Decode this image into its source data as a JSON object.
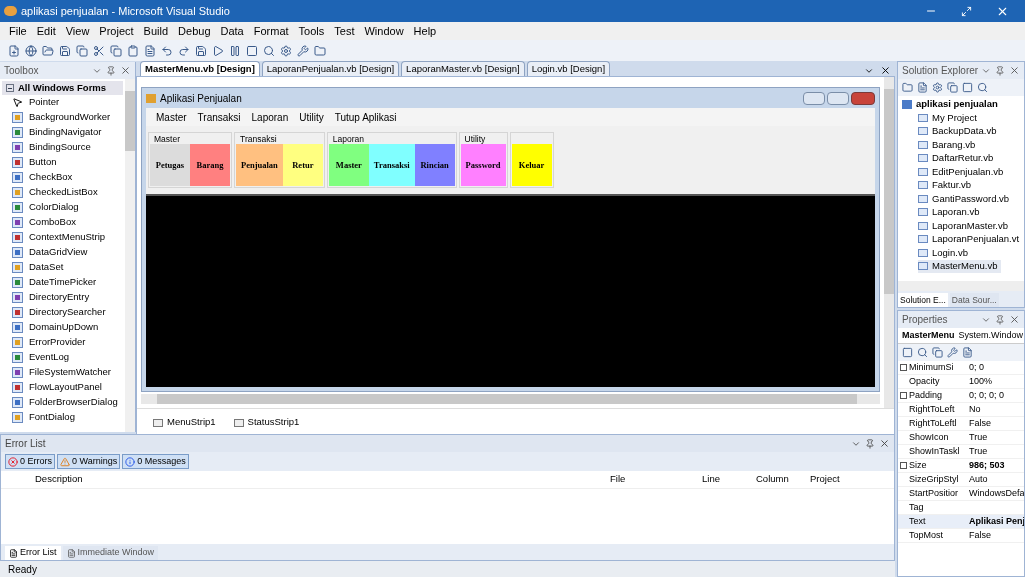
{
  "window": {
    "title": "aplikasi penjualan - Microsoft Visual Studio"
  },
  "menu": [
    "File",
    "Edit",
    "View",
    "Project",
    "Build",
    "Debug",
    "Data",
    "Format",
    "Tools",
    "Test",
    "Window",
    "Help"
  ],
  "toolbox": {
    "title": "Toolbox",
    "category": "All Windows Forms",
    "items": [
      "Pointer",
      "BackgroundWorker",
      "BindingNavigator",
      "BindingSource",
      "Button",
      "CheckBox",
      "CheckedListBox",
      "ColorDialog",
      "ComboBox",
      "ContextMenuStrip",
      "DataGridView",
      "DataSet",
      "DateTimePicker",
      "DirectoryEntry",
      "DirectorySearcher",
      "DomainUpDown",
      "ErrorProvider",
      "EventLog",
      "FileSystemWatcher",
      "FlowLayoutPanel",
      "FolderBrowserDialog",
      "FontDialog"
    ]
  },
  "tabs": [
    {
      "label": "MasterMenu.vb [Design]",
      "selected": true
    },
    {
      "label": "LaporanPenjualan.vb [Design]",
      "selected": false
    },
    {
      "label": "LaporanMaster.vb [Design]",
      "selected": false
    },
    {
      "label": "Login.vb [Design]",
      "selected": false
    }
  ],
  "form": {
    "title": "Aplikasi Penjualan",
    "menu": [
      "Master",
      "Transaksi",
      "Laporan",
      "Utility",
      "Tutup Aplikasi"
    ],
    "groups": [
      {
        "title": "Master",
        "buttons": [
          {
            "label": "Petugas",
            "color": "#dcdcdc"
          },
          {
            "label": "Barang",
            "color": "#ff8080"
          }
        ]
      },
      {
        "title": "Transaksi",
        "buttons": [
          {
            "label": "Penjualan",
            "color": "#ffc080"
          },
          {
            "label": "Retur",
            "color": "#ffff80"
          }
        ]
      },
      {
        "title": "Laporan",
        "buttons": [
          {
            "label": "Master",
            "color": "#80ff80"
          },
          {
            "label": "Transaksi",
            "color": "#80ffff"
          },
          {
            "label": "Rincian",
            "color": "#8080ff"
          }
        ]
      },
      {
        "title": "Utility",
        "buttons": [
          {
            "label": "Password",
            "color": "#ff80ff"
          }
        ]
      },
      {
        "buttons": [
          {
            "label": "Keluar",
            "color": "#ffff00"
          }
        ]
      }
    ],
    "components": [
      "MenuStrip1",
      "StatusStrip1"
    ]
  },
  "solution_explorer": {
    "title": "Solution Explorer",
    "root": "aplikasi penjualan",
    "items": [
      {
        "label": "My Project",
        "selected": false
      },
      {
        "label": "BackupData.vb",
        "selected": false
      },
      {
        "label": "Barang.vb",
        "selected": false
      },
      {
        "label": "DaftarRetur.vb",
        "selected": false
      },
      {
        "label": "EditPenjualan.vb",
        "selected": false
      },
      {
        "label": "Faktur.vb",
        "selected": false
      },
      {
        "label": "GantiPassword.vb",
        "selected": false
      },
      {
        "label": "Laporan.vb",
        "selected": false
      },
      {
        "label": "LaporanMaster.vb",
        "selected": false
      },
      {
        "label": "LaporanPenjualan.vt",
        "selected": false
      },
      {
        "label": "Login.vb",
        "selected": false
      },
      {
        "label": "MasterMenu.vb",
        "selected": true
      }
    ],
    "tabs": [
      {
        "label": "Solution E...",
        "selected": true
      },
      {
        "label": "Data Sour...",
        "selected": false
      }
    ]
  },
  "properties": {
    "title": "Properties",
    "object": "MasterMenu",
    "type": "System.Window",
    "rows": [
      {
        "name": "MinimumSi",
        "value": "0; 0",
        "expandable": true,
        "bold": false,
        "selected": false
      },
      {
        "name": "Opacity",
        "value": "100%",
        "expandable": false,
        "bold": false,
        "selected": false
      },
      {
        "name": "Padding",
        "value": "0; 0; 0; 0",
        "expandable": true,
        "bold": false,
        "selected": false
      },
      {
        "name": "RightToLeft",
        "value": "No",
        "expandable": false,
        "bold": false,
        "selected": false
      },
      {
        "name": "RightToLeftl",
        "value": "False",
        "expandable": false,
        "bold": false,
        "selected": false
      },
      {
        "name": "ShowIcon",
        "value": "True",
        "expandable": false,
        "bold": false,
        "selected": false
      },
      {
        "name": "ShowInTaskl",
        "value": "True",
        "expandable": false,
        "bold": false,
        "selected": false
      },
      {
        "name": "Size",
        "value": "986; 503",
        "expandable": true,
        "bold": true,
        "selected": false
      },
      {
        "name": "SizeGripStyl",
        "value": "Auto",
        "expandable": false,
        "bold": false,
        "selected": false
      },
      {
        "name": "StartPositior",
        "value": "WindowsDefa",
        "expandable": false,
        "bold": false,
        "selected": false
      },
      {
        "name": "Tag",
        "expandable": false,
        "selected": false
      },
      {
        "name": "Text",
        "value": "Aplikasi Penj",
        "expandable": false,
        "bold": true,
        "selected": true
      },
      {
        "name": "TopMost",
        "value": "False",
        "expandable": false,
        "bold": false,
        "selected": false
      }
    ]
  },
  "error_list": {
    "title": "Error List",
    "filters": [
      {
        "kind": "error",
        "label": "0 Errors"
      },
      {
        "kind": "warning",
        "label": "0 Warnings"
      },
      {
        "kind": "info",
        "label": "0 Messages"
      }
    ],
    "columns": [
      "Description",
      "File",
      "Line",
      "Column",
      "Project"
    ],
    "tabs": [
      {
        "label": "Error List",
        "selected": true
      },
      {
        "label": "Immediate Window",
        "selected": false
      }
    ]
  },
  "status_bar": "Ready"
}
